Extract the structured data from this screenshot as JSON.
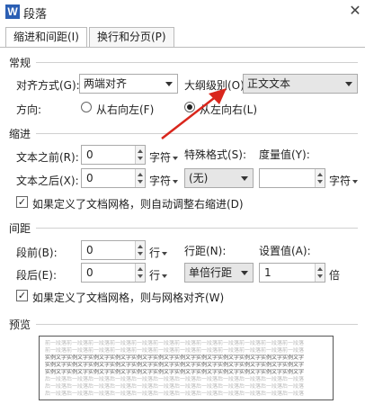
{
  "window": {
    "app_icon_text": "W",
    "title": "段落",
    "close_symbol": "✕"
  },
  "tabs": [
    {
      "label": "缩进和间距(I)",
      "active": true
    },
    {
      "label": "换行和分页(P)",
      "active": false
    }
  ],
  "general": {
    "section_title": "常规",
    "alignment_label": "对齐方式(G):",
    "alignment_value": "两端对齐",
    "outline_label": "大纲级别(O):",
    "outline_value": "正文文本",
    "direction_label": "方向:",
    "rtl_label": "从右向左(F)",
    "ltr_label": "从左向右(L)",
    "selected_direction": "ltr"
  },
  "indent": {
    "section_title": "缩进",
    "before_label": "文本之前(R):",
    "before_value": "0",
    "before_unit": "字符",
    "after_label": "文本之后(X):",
    "after_value": "0",
    "after_unit": "字符",
    "special_label": "特殊格式(S):",
    "special_value": "(无)",
    "measure_label": "度量值(Y):",
    "measure_value": "",
    "measure_unit": "字符",
    "auto_adjust_label": "如果定义了文档网格，则自动调整右缩进(D)",
    "auto_adjust_checked": true
  },
  "spacing": {
    "section_title": "间距",
    "before_label": "段前(B):",
    "before_value": "0",
    "before_unit": "行",
    "after_label": "段后(E):",
    "after_value": "0",
    "after_unit": "行",
    "line_spacing_label": "行距(N):",
    "line_spacing_value": "单倍行距",
    "set_value_label": "设置值(A):",
    "set_value": "1",
    "set_value_unit": "倍",
    "snap_grid_label": "如果定义了文档网格，则与网格对齐(W)",
    "snap_grid_checked": true
  },
  "preview": {
    "section_title": "预览",
    "lines": [
      "前一段落前一段落前一段落前一段落前一段落前一段落前一段落前一段落前一段落前一段落前一段落前一段落",
      "前一段落前一段落前一段落前一段落前一段落前一段落前一段落前一段落前一段落前一段落前一段落前一段落",
      "实例文字实例文字实例文字实例文字实例文字实例文字实例文字实例文字实例文字实例文字实例文字实例文字",
      "实例文字实例文字实例文字实例文字实例文字实例文字实例文字实例文字实例文字实例文字实例文字实例文字",
      "实例文字实例文字实例文字实例文字实例文字实例文字实例文字实例文字实例文字实例文字实例文字实例文字",
      "后一段落后一段落后一段落后一段落后一段落后一段落后一段落后一段落后一段落后一段落后一段落后一段落",
      "后一段落后一段落后一段落后一段落后一段落后一段落后一段落后一段落后一段落后一段落后一段落后一段落",
      "后一段落后一段落后一段落后一段落后一段落后一段落后一段落后一段落后一段落后一段落后一段落后一段落"
    ]
  },
  "colors": {
    "annotation_arrow": "#d9261c",
    "app_icon": "#2b5fb4"
  }
}
